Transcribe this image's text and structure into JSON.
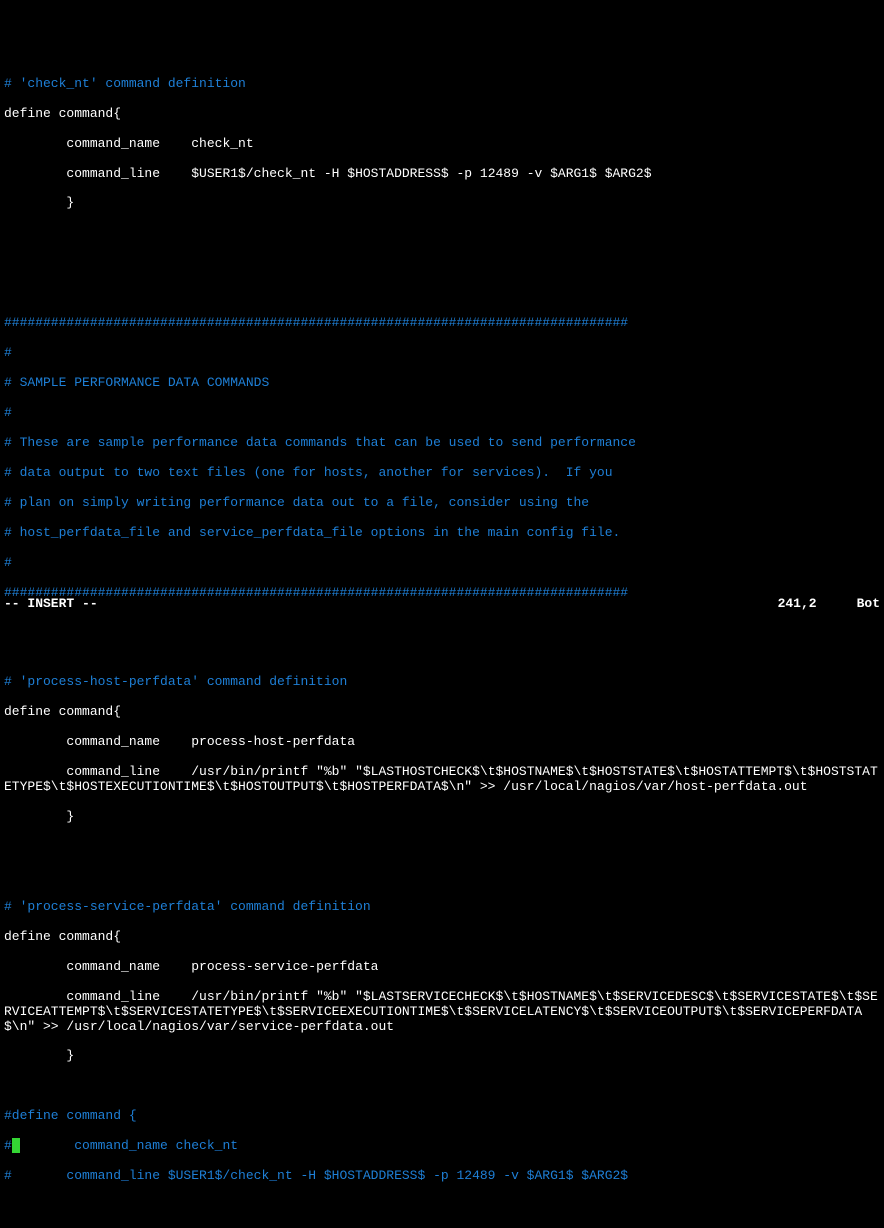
{
  "lines": {
    "l1": "# 'check_nt' command definition",
    "l2": "define command{",
    "l3": "        command_name    check_nt",
    "l4": "        command_line    $USER1$/check_nt -H $HOSTADDRESS$ -p 12489 -v $ARG1$ $ARG2$",
    "l5": "        }",
    "l6": "",
    "l7": "",
    "l8": "",
    "l9": "################################################################################",
    "l10": "#",
    "l11": "# SAMPLE PERFORMANCE DATA COMMANDS",
    "l12": "#",
    "l13": "# These are sample performance data commands that can be used to send performance",
    "l14": "# data output to two text files (one for hosts, another for services).  If you",
    "l15": "# plan on simply writing performance data out to a file, consider using the",
    "l16": "# host_perfdata_file and service_perfdata_file options in the main config file.",
    "l17": "#",
    "l18": "################################################################################",
    "l19": "",
    "l20": "",
    "l21": "# 'process-host-perfdata' command definition",
    "l22": "define command{",
    "l23": "        command_name    process-host-perfdata",
    "l24": "        command_line    /usr/bin/printf \"%b\" \"$LASTHOSTCHECK$\\t$HOSTNAME$\\t$HOSTSTATE$\\t$HOSTATTEMPT$\\t$HOSTSTATETYPE$\\t$HOSTEXECUTIONTIME$\\t$HOSTOUTPUT$\\t$HOSTPERFDATA$\\n\" >> /usr/local/nagios/var/host-perfdata.out",
    "l25": "        }",
    "l26": "",
    "l27": "",
    "l28": "# 'process-service-perfdata' command definition",
    "l29": "define command{",
    "l30": "        command_name    process-service-perfdata",
    "l31": "        command_line    /usr/bin/printf \"%b\" \"$LASTSERVICECHECK$\\t$HOSTNAME$\\t$SERVICEDESC$\\t$SERVICESTATE$\\t$SERVICEATTEMPT$\\t$SERVICESTATETYPE$\\t$SERVICEEXECUTIONTIME$\\t$SERVICELATENCY$\\t$SERVICEOUTPUT$\\t$SERVICEPERFDATA$\\n\" >> /usr/local/nagios/var/service-perfdata.out",
    "l32": "        }",
    "l33": "",
    "l34": "#define command {",
    "l35a": "#",
    "l35b": "       command_name check_nt",
    "l36": "#       command_line $USER1$/check_nt -H $HOSTADDRESS$ -p 12489 -v $ARG1$ $ARG2$"
  },
  "status": {
    "mode": "-- INSERT --",
    "position": "241,2",
    "scroll": "Bot"
  },
  "cursor": " "
}
